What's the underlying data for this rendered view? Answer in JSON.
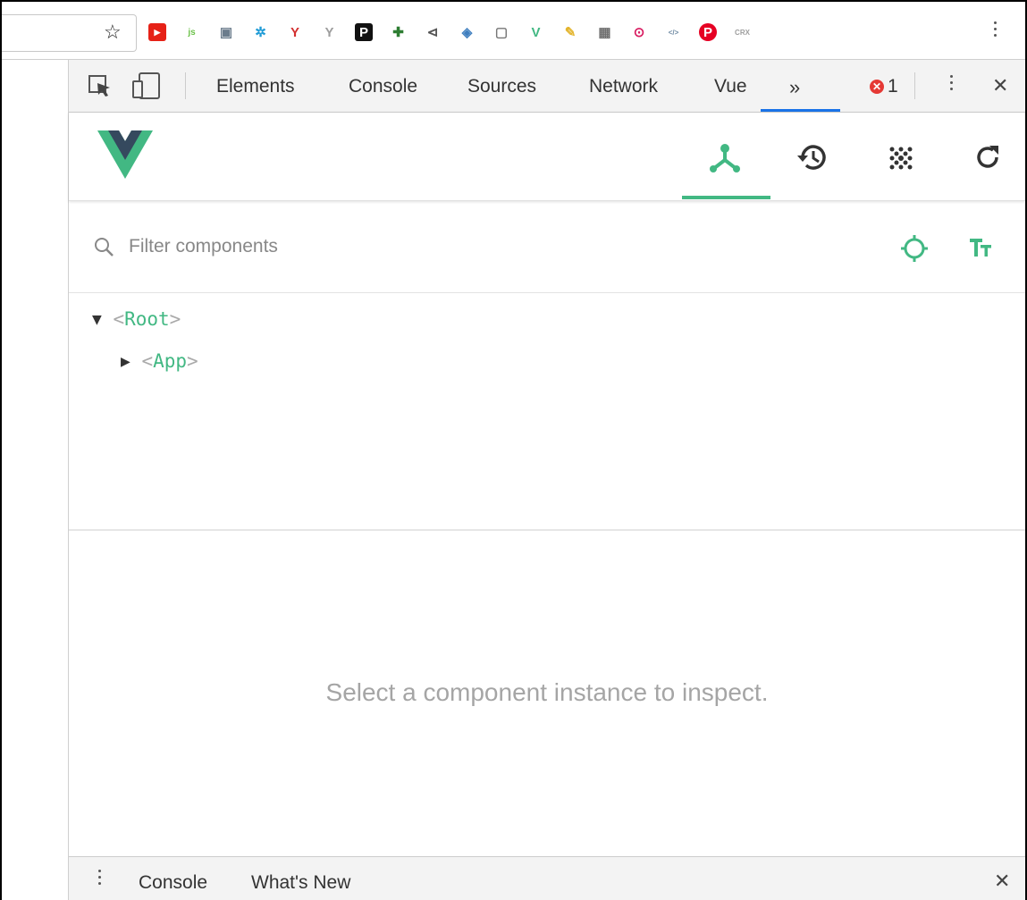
{
  "chrome": {
    "extensions": [
      {
        "name": "youtube-extension-icon",
        "color": "#e62117",
        "glyph": "▶"
      },
      {
        "name": "nodejs-extension-icon",
        "color": "#6cc24a",
        "glyph": "js"
      },
      {
        "name": "extension-3-icon",
        "color": "#6b7c8c",
        "glyph": "▣"
      },
      {
        "name": "extension-4-icon",
        "color": "#1f9bd6",
        "glyph": "✲"
      },
      {
        "name": "extension-5-icon",
        "color": "#d32f2f",
        "glyph": "Y"
      },
      {
        "name": "extension-6-icon",
        "color": "#9e9e9e",
        "glyph": "Y"
      },
      {
        "name": "extension-p-icon",
        "color": "#111111",
        "glyph": "P"
      },
      {
        "name": "extension-8-icon",
        "color": "#2e7d32",
        "glyph": "✚"
      },
      {
        "name": "megaphone-extension-icon",
        "color": "#555555",
        "glyph": "⊲"
      },
      {
        "name": "extension-10-icon",
        "color": "#3f7fbf",
        "glyph": "◈"
      },
      {
        "name": "extension-11-icon",
        "color": "#777777",
        "glyph": "▢"
      },
      {
        "name": "vue-extension-icon",
        "color": "#42b883",
        "glyph": "V"
      },
      {
        "name": "highlighter-extension-icon",
        "color": "#e3b42c",
        "glyph": "✎"
      },
      {
        "name": "extension-14-icon",
        "color": "#6d6d6d",
        "glyph": "▦"
      },
      {
        "name": "extension-15-icon",
        "color": "#d81b60",
        "glyph": "⊙"
      },
      {
        "name": "code-extension-icon",
        "color": "#6f8aa3",
        "glyph": "</>"
      },
      {
        "name": "pinterest-extension-icon",
        "color": "#e60023",
        "glyph": "P"
      },
      {
        "name": "crx-extension-icon",
        "color": "#9e9e9e",
        "glyph": "CRX"
      }
    ]
  },
  "devtools": {
    "tabs": [
      "Elements",
      "Console",
      "Sources",
      "Network",
      "Vue"
    ],
    "more": "»",
    "error_count": "1",
    "close": "✕"
  },
  "vue": {
    "filter_placeholder": "Filter components",
    "tree": {
      "root": "Root",
      "child": "App"
    },
    "empty_message": "Select a component instance to inspect.",
    "colors": {
      "accent": "#42b883",
      "logo_dark": "#35495e"
    }
  },
  "drawer": {
    "tabs": [
      "Console",
      "What's New"
    ],
    "close": "✕"
  }
}
